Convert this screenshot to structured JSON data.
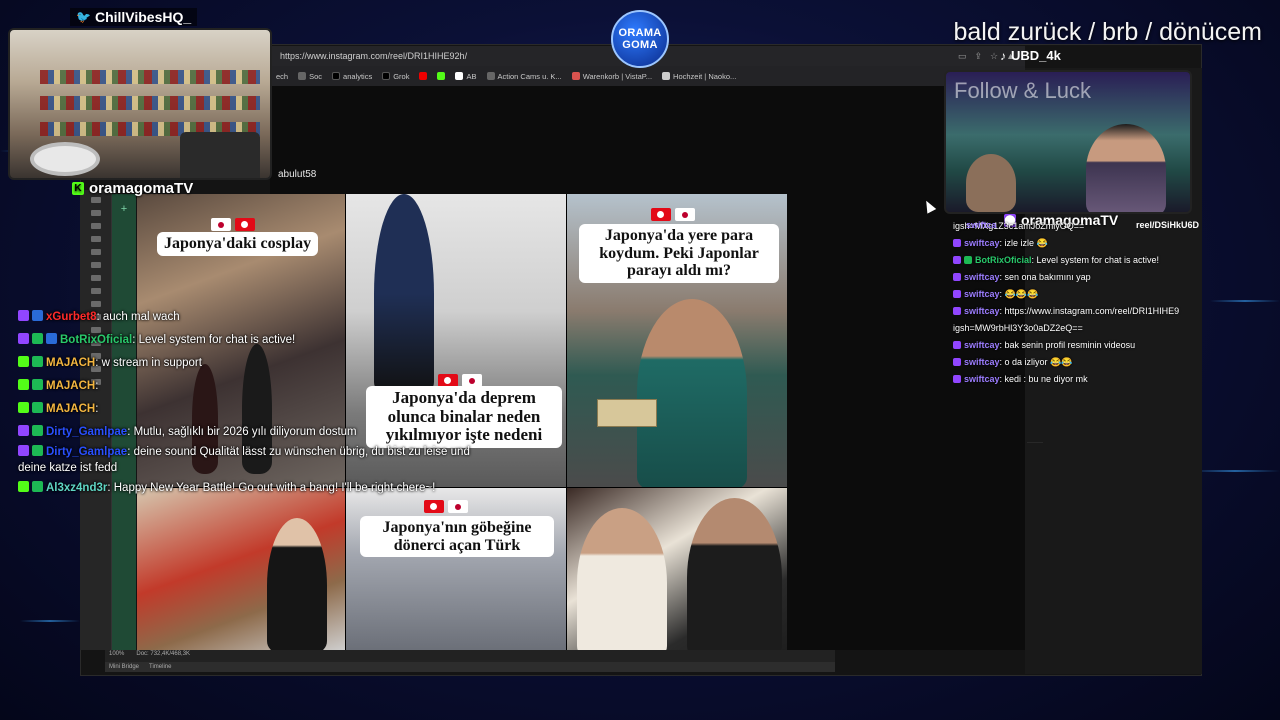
{
  "overlay": {
    "brb_text": "bald zurück / brb / dönücem",
    "logo_line1": "ORAMA",
    "logo_line2": "GOMA",
    "twitter_handle": "ChillVibesHQ_",
    "left_cam_name": "oramagomaTV",
    "right_cam_name": "oramagomaTV",
    "right_cam_overlay": "Follow & Luck",
    "tiktok_handle": "UBD_4k"
  },
  "browser": {
    "url": "https://www.instagram.com/reel/DRI1HIHE92h/",
    "bookmarks": [
      "ech",
      "Soc",
      "analytics",
      "Grok",
      "AB",
      "Action Cams u. K...",
      "Warenkorb | VistaP...",
      "Hochzeit | Naoko..."
    ]
  },
  "instagram": {
    "username": "abulut58",
    "tiles": [
      {
        "caption": "Japonya'daki cosplay"
      },
      {
        "caption": "Japonya'da deprem olunca binalar neden yıkılmıyor işte nedeni"
      },
      {
        "caption": "Japonya'da yere para koydum. Peki Japonlar parayı aldı mı?"
      },
      {
        "caption": ""
      },
      {
        "caption": "Japonya'nın göbeğine dönerci açan Türk"
      },
      {
        "caption": ""
      }
    ]
  },
  "photoshop": {
    "zoom": "100%",
    "doc_info": "Doc: 732,4K/468,3K",
    "tab1": "Mini Bridge",
    "tab2": "Timeline"
  },
  "left_chat": [
    {
      "user": "xGurbet8",
      "color": "red",
      "text": ": auch mal wach"
    },
    {
      "user": "BotRixOficial",
      "color": "green",
      "text": ": Level system for chat is active!"
    },
    {
      "user": "MAJACH",
      "color": "gold",
      "text": ": w stream in support"
    },
    {
      "user": "MAJACH",
      "color": "gold",
      "text": ":"
    },
    {
      "user": "MAJACH",
      "color": "gold",
      "text": ":"
    },
    {
      "user": "Dirty_Gamlpae",
      "color": "blue",
      "text": ": Mutlu, sağlıklı bir 2026 yılı diliyorum dostum"
    },
    {
      "user": "Dirty_Gamlpae",
      "color": "blue",
      "text": ": deine sound Qualität lässt zu wünschen übrig, du bist zu leise und deine katze ist fedd"
    },
    {
      "user": "Al3xz4nd3r",
      "color": "teal",
      "text": ": Happy New Year Battle! Go out with a bang! I'll be right chere~!"
    }
  ],
  "right_chat": [
    {
      "user": "",
      "text": "igsh=MXg1Z3c1amJoZmlyOQ=="
    },
    {
      "user": "swiftcay",
      "text": ": izle izle 😂"
    },
    {
      "user": "BotRixOficial",
      "text": ": Level system for chat is active!"
    },
    {
      "user": "swiftcay",
      "text": ": sen ona bakımını yap"
    },
    {
      "user": "swiftcay",
      "text": ": 😂😂😂"
    },
    {
      "user": "swiftcay",
      "text": ": https://www.instagram.com/reel/DRI1HIHE9"
    },
    {
      "user": "",
      "text": "igsh=MW9rbHl3Y3o0aDZ2eQ=="
    },
    {
      "user": "swiftcay",
      "text": ": bak senin profil resminin videosu"
    },
    {
      "user": "swiftcay",
      "text": ": o da izliyor 😂😂"
    },
    {
      "user": "swiftcay",
      "text": ": kedi : bu ne diyor mk"
    }
  ],
  "right_chat_top": {
    "user": "swiftca",
    "text": "reel/DSiHkU6D"
  }
}
